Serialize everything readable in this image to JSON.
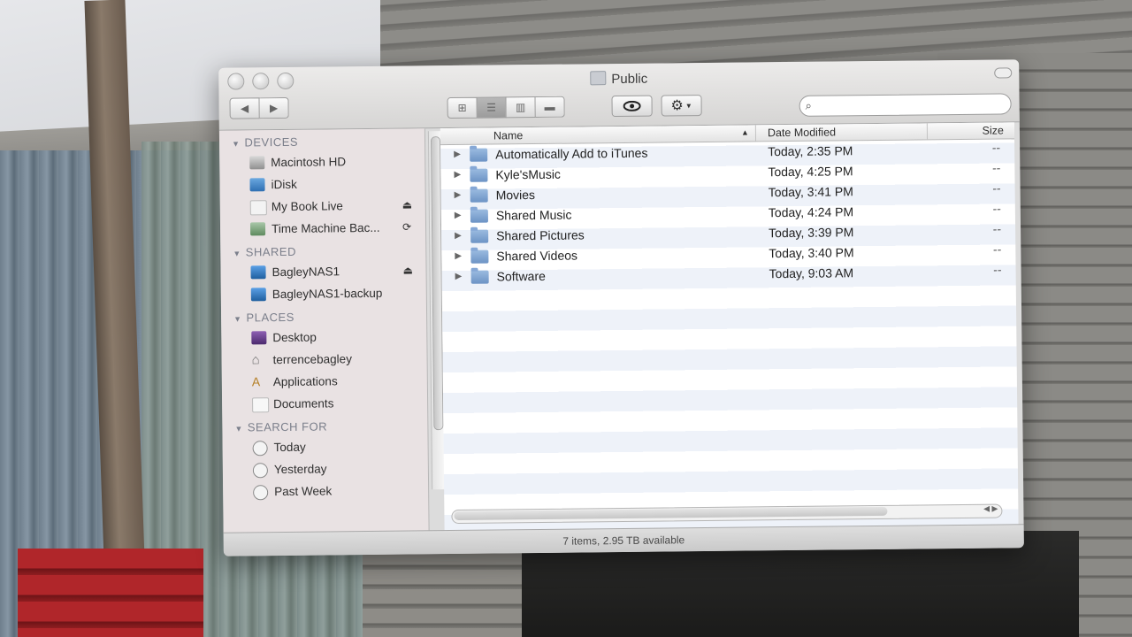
{
  "window": {
    "title": "Public",
    "status": "7 items, 2.95 TB available",
    "search_placeholder": ""
  },
  "toolbar": {
    "back_icon": "back-arrow-icon",
    "forward_icon": "forward-arrow-icon",
    "view_modes": [
      "icon-view",
      "list-view",
      "column-view",
      "cover-flow-view"
    ],
    "active_view": "list-view"
  },
  "sidebar": {
    "sections": [
      {
        "title": "DEVICES",
        "items": [
          {
            "label": "Macintosh HD",
            "icon": "hard-drive-icon"
          },
          {
            "label": "iDisk",
            "icon": "idisk-icon"
          },
          {
            "label": "My Book Live",
            "icon": "external-drive-icon",
            "badge": "eject-icon"
          },
          {
            "label": "Time Machine Bac...",
            "icon": "time-machine-drive-icon",
            "badge": "sync-icon"
          }
        ]
      },
      {
        "title": "SHARED",
        "items": [
          {
            "label": "BagleyNAS1",
            "icon": "network-server-icon",
            "badge": "eject-icon"
          },
          {
            "label": "BagleyNAS1-backup",
            "icon": "network-server-icon"
          }
        ]
      },
      {
        "title": "PLACES",
        "items": [
          {
            "label": "Desktop",
            "icon": "desktop-icon"
          },
          {
            "label": "terrencebagley",
            "icon": "home-icon"
          },
          {
            "label": "Applications",
            "icon": "applications-icon"
          },
          {
            "label": "Documents",
            "icon": "documents-icon"
          }
        ]
      },
      {
        "title": "SEARCH FOR",
        "items": [
          {
            "label": "Today",
            "icon": "clock-icon"
          },
          {
            "label": "Yesterday",
            "icon": "clock-icon"
          },
          {
            "label": "Past Week",
            "icon": "clock-icon"
          }
        ]
      }
    ]
  },
  "list": {
    "columns": {
      "name": "Name",
      "date": "Date Modified",
      "size": "Size"
    },
    "rows": [
      {
        "name": "Automatically Add to iTunes",
        "date": "Today, 2:35 PM",
        "size": "--"
      },
      {
        "name": "Kyle'sMusic",
        "date": "Today, 4:25 PM",
        "size": "--"
      },
      {
        "name": "Movies",
        "date": "Today, 3:41 PM",
        "size": "--"
      },
      {
        "name": "Shared Music",
        "date": "Today, 4:24 PM",
        "size": "--"
      },
      {
        "name": "Shared Pictures",
        "date": "Today, 3:39 PM",
        "size": "--"
      },
      {
        "name": "Shared Videos",
        "date": "Today, 3:40 PM",
        "size": "--"
      },
      {
        "name": "Software",
        "date": "Today, 9:03 AM",
        "size": "--"
      }
    ]
  }
}
